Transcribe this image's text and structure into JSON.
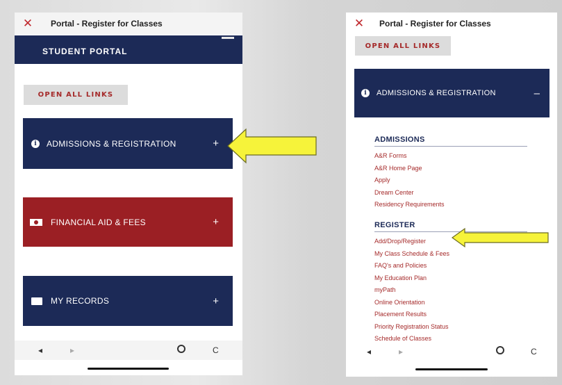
{
  "left": {
    "topbar": {
      "close_icon": "x-icon",
      "title": "Portal - Register for Classes"
    },
    "nav_band": {
      "label": "STUDENT PORTAL",
      "menu_icon": "hamburger-icon"
    },
    "open_all_label": "OPEN ALL LINKS",
    "sections": [
      {
        "label": "ADMISSIONS & REGISTRATION",
        "icon": "info-icon",
        "toggle": "+",
        "color": "#1c2a57"
      },
      {
        "label": "FINANCIAL AID & FEES",
        "icon": "money-icon",
        "toggle": "+",
        "color": "#9b1f24"
      },
      {
        "label": "MY RECORDS",
        "icon": "folder-icon",
        "toggle": "+",
        "color": "#1c2a57"
      }
    ],
    "bottom": {
      "back": "◂",
      "forward": "▸",
      "compass_icon": "compass-icon",
      "reload": "C"
    }
  },
  "right": {
    "topbar": {
      "close_icon": "x-icon",
      "title": "Portal - Register for Classes"
    },
    "open_all_label": "OPEN ALL LINKS",
    "section": {
      "label": "ADMISSIONS & REGISTRATION",
      "icon": "info-icon",
      "toggle": "–"
    },
    "admissions": {
      "header": "ADMISSIONS",
      "links": [
        "A&R Forms",
        "A&R Home Page",
        "Apply",
        "Dream Center",
        "Residency Requirements"
      ]
    },
    "register": {
      "header": "REGISTER",
      "links": [
        "Add/Drop/Register",
        "My Class Schedule & Fees",
        "FAQ's and Policies",
        "My Education Plan",
        "myPath",
        "Online Orientation",
        "Placement Results",
        "Priority Registration Status",
        "Schedule of Classes"
      ]
    },
    "bottom": {
      "back": "◂",
      "forward": "▸",
      "compass_icon": "compass-icon",
      "reload": "C"
    }
  },
  "colors": {
    "navy": "#1c2a57",
    "crimson": "#9b1f24",
    "link": "#a52a2a",
    "arrow": "#f6f33a"
  }
}
